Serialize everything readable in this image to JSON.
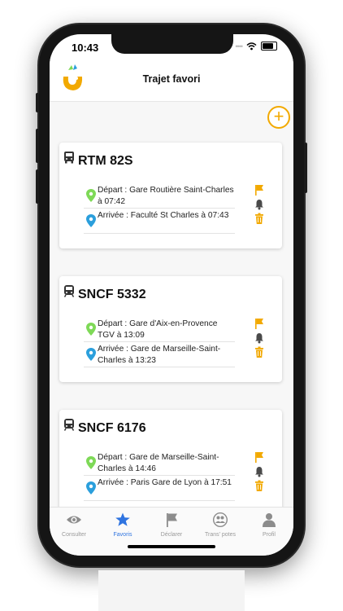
{
  "status_bar": {
    "time": "10:43"
  },
  "header": {
    "title": "Trajet favori",
    "logo": "app-logo"
  },
  "toolbar": {
    "add_icon": "plus-circle-icon",
    "add_label": "+"
  },
  "favorites": [
    {
      "line": "RTM 82S",
      "icon": "bus-icon",
      "departure": "Départ : Gare Routière Saint-Charles à 07:42",
      "arrival": "Arrivée : Faculté St Charles à 07:43"
    },
    {
      "line": "SNCF 5332",
      "icon": "train-icon",
      "departure": "Départ : Gare d'Aix-en-Provence TGV à 13:09",
      "arrival": "Arrivée : Gare de Marseille-Saint-Charles à 13:23"
    },
    {
      "line": "SNCF 6176",
      "icon": "train-icon",
      "departure": "Départ : Gare de Marseille-Saint-Charles à 14:46",
      "arrival": "Arrivée : Paris Gare de Lyon à 17:51"
    }
  ],
  "actions": {
    "flag": "flag-icon",
    "alert": "bell-icon",
    "delete": "trash-icon"
  },
  "tabs": [
    {
      "label": "Consulter",
      "icon": "eye-icon"
    },
    {
      "label": "Favoris",
      "icon": "star-icon",
      "active": true
    },
    {
      "label": "Déclarer",
      "icon": "flag-icon"
    },
    {
      "label": "Trans' potes",
      "icon": "people-icon"
    },
    {
      "label": "Profil",
      "icon": "person-icon"
    }
  ],
  "colors": {
    "accent": "#f2a900",
    "active_tab": "#2f74e0",
    "departure_pin": "#7ed957",
    "arrival_pin": "#2b9fdc",
    "bell": "#4a4a4a"
  }
}
